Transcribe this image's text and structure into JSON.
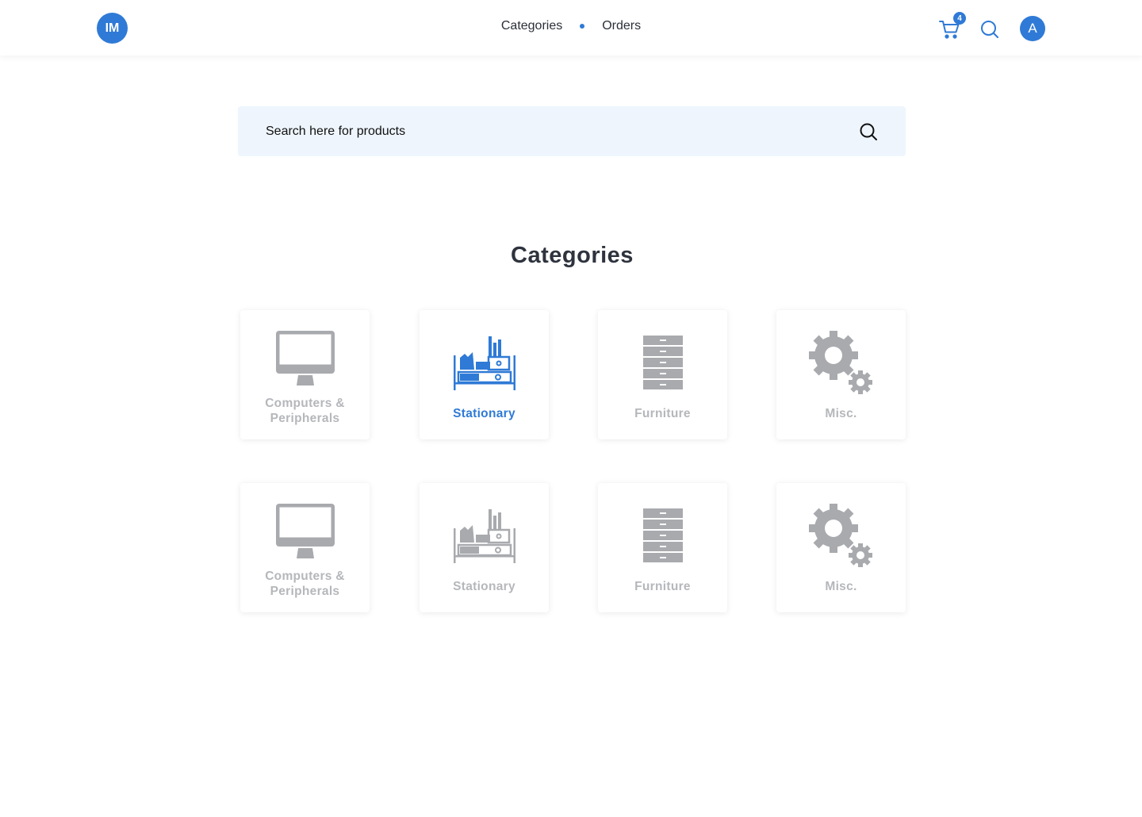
{
  "header": {
    "logo_text": "IM",
    "nav": [
      {
        "label": "Categories"
      },
      {
        "label": "Orders"
      }
    ],
    "cart_count": "4",
    "avatar_initial": "A"
  },
  "search": {
    "placeholder": "Search here for products"
  },
  "categories": {
    "title": "Categories",
    "items": [
      {
        "label": "Computers & Peripherals",
        "icon": "monitor-icon",
        "active": false
      },
      {
        "label": "Stationary",
        "icon": "stationery-icon",
        "active": true
      },
      {
        "label": "Furniture",
        "icon": "cabinet-icon",
        "active": false
      },
      {
        "label": "Misc.",
        "icon": "gears-icon",
        "active": false
      },
      {
        "label": "Computers & Peripherals",
        "icon": "monitor-icon",
        "active": false
      },
      {
        "label": "Stationary",
        "icon": "stationery-icon",
        "active": false
      },
      {
        "label": "Furniture",
        "icon": "cabinet-icon",
        "active": false
      },
      {
        "label": "Misc.",
        "icon": "gears-icon",
        "active": false
      }
    ]
  },
  "colors": {
    "accent": "#2f7ad6",
    "inactive_icon": "#a8aaae",
    "inactive_label": "#b5b7bb",
    "search_bg": "#eef5fd"
  }
}
